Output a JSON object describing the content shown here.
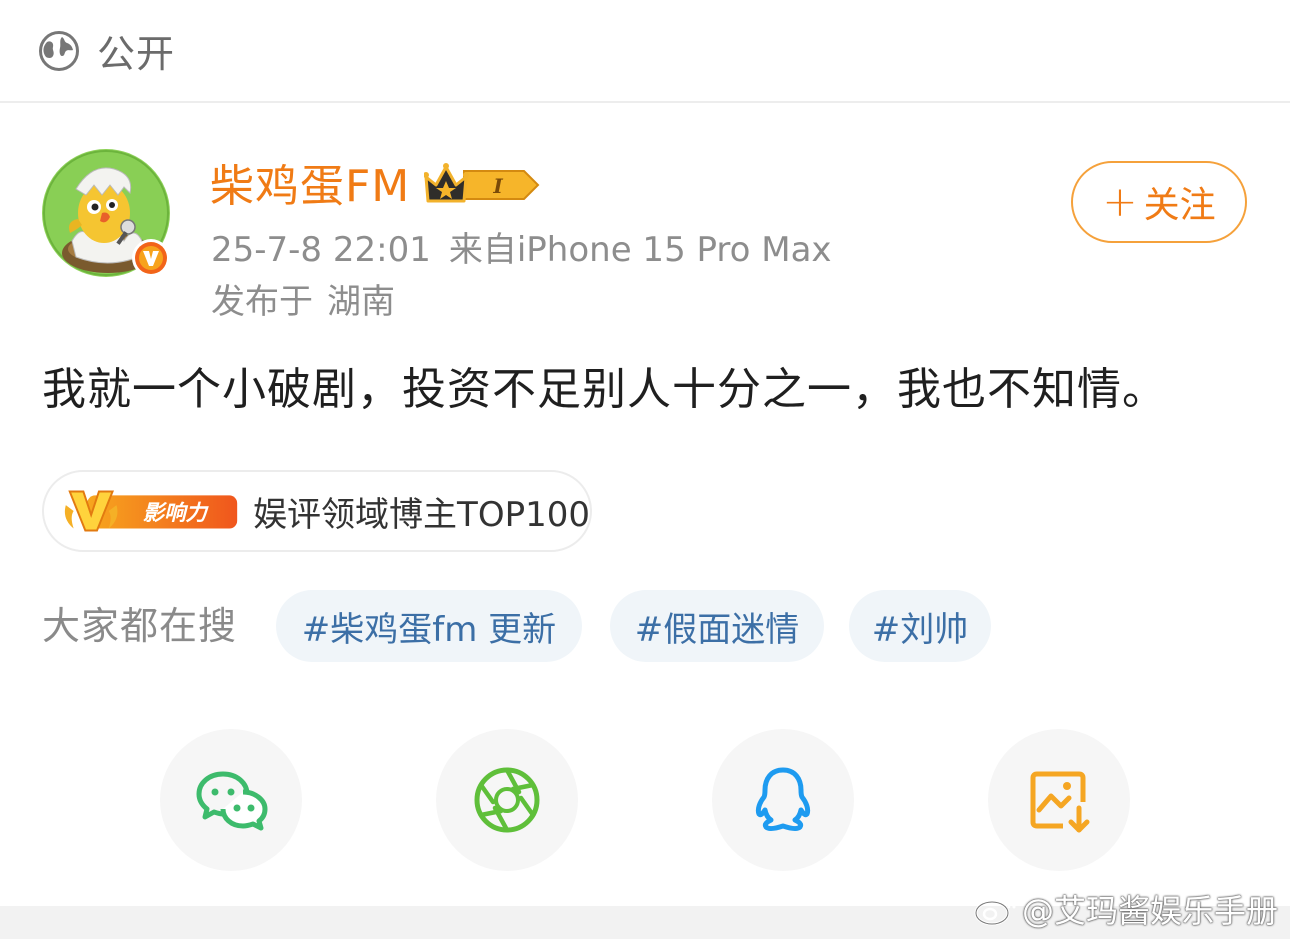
{
  "visibility": {
    "icon": "globe-icon",
    "label": "公开"
  },
  "user": {
    "name": "柴鸡蛋FM",
    "level_badge": "crown-level-badge",
    "level_text": "I",
    "verified": true,
    "verified_mark": "V",
    "timestamp": "25-7-8 22:01",
    "source": "来自iPhone 15 Pro Max",
    "location_prefix": "发布于",
    "location": "湖南"
  },
  "follow_button": {
    "plus": "+",
    "label": "关注"
  },
  "post": {
    "text": "我就一个小破剧，投资不足别人十分之一，我也不知情。"
  },
  "influence": {
    "badge_letter": "V",
    "badge_text": "影响力",
    "label": "娱评领域博主TOP100"
  },
  "hot_search": {
    "label": "大家都在搜",
    "tags": [
      "#柴鸡蛋fm 更新",
      "#假面迷情",
      "#刘帅"
    ]
  },
  "share": [
    {
      "icon": "wechat-icon",
      "color": "#3dbb6c"
    },
    {
      "icon": "moments-icon",
      "color": "#5fbf3a"
    },
    {
      "icon": "qq-icon",
      "color": "#1e9bf0"
    },
    {
      "icon": "save-image-icon",
      "color": "#f5a623"
    }
  ],
  "watermark": {
    "icon": "weibo-logo-icon",
    "text": "@艾玛酱娱乐手册"
  },
  "colors": {
    "accent_orange": "#f07b15",
    "hashtag_blue": "#3c6fa6",
    "hashtag_bg": "#f0f5f9"
  }
}
